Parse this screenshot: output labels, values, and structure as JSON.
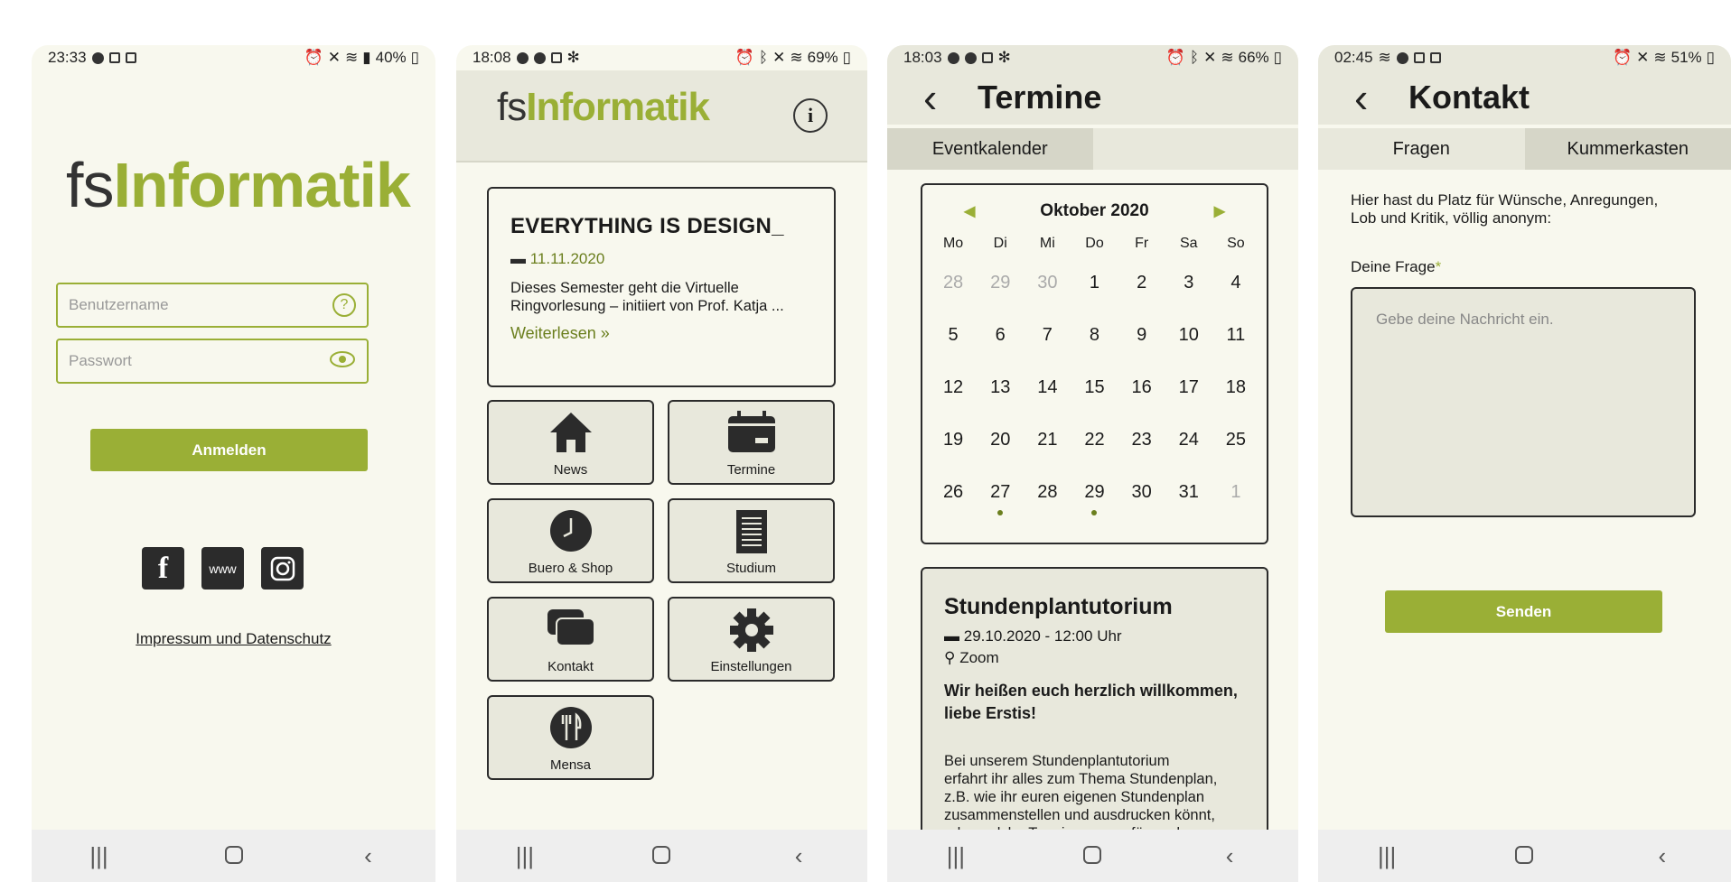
{
  "colors": {
    "accent": "#9aaf36",
    "dark": "#2b2b2b",
    "bg": "#f8f8ee",
    "header": "#e8e8dc"
  },
  "s1": {
    "status": {
      "time": "23:33",
      "battery": "40%"
    },
    "logo": {
      "fs": "fs",
      "name": "Informatik"
    },
    "username_placeholder": "Benutzername",
    "password_placeholder": "Passwort",
    "login": "Anmelden",
    "www": "www",
    "impressum": "Impressum und Datenschutz"
  },
  "s2": {
    "status": {
      "time": "18:08",
      "battery": "69%"
    },
    "logo": {
      "fs": "fs",
      "name": "Informatik"
    },
    "news": {
      "title": "EVERYTHING IS DESIGN_",
      "date": "11.11.2020",
      "line1": "Dieses Semester geht die Virtuelle",
      "line2": "Ringvorlesung – initiiert von Prof. Katja ...",
      "more": "Weiterlesen"
    },
    "tiles": {
      "news": "News",
      "termine": "Termine",
      "buero": "Buero & Shop",
      "studium": "Studium",
      "kontakt": "Kontakt",
      "einstellungen": "Einstellungen",
      "mensa": "Mensa"
    }
  },
  "s3": {
    "status": {
      "time": "18:03",
      "battery": "66%"
    },
    "title": "Termine",
    "tab": "Eventkalender",
    "month": "Oktober 2020",
    "weekdays": [
      "Mo",
      "Di",
      "Mi",
      "Do",
      "Fr",
      "Sa",
      "So"
    ],
    "days": [
      {
        "d": "28",
        "m": true
      },
      {
        "d": "29",
        "m": true
      },
      {
        "d": "30",
        "m": true
      },
      {
        "d": "1"
      },
      {
        "d": "2"
      },
      {
        "d": "3"
      },
      {
        "d": "4"
      },
      {
        "d": "5"
      },
      {
        "d": "6"
      },
      {
        "d": "7"
      },
      {
        "d": "8"
      },
      {
        "d": "9"
      },
      {
        "d": "10"
      },
      {
        "d": "11"
      },
      {
        "d": "12"
      },
      {
        "d": "13"
      },
      {
        "d": "14"
      },
      {
        "d": "15"
      },
      {
        "d": "16"
      },
      {
        "d": "17"
      },
      {
        "d": "18"
      },
      {
        "d": "19"
      },
      {
        "d": "20"
      },
      {
        "d": "21"
      },
      {
        "d": "22"
      },
      {
        "d": "23"
      },
      {
        "d": "24"
      },
      {
        "d": "25"
      },
      {
        "d": "26"
      },
      {
        "d": "27",
        "e": true
      },
      {
        "d": "28"
      },
      {
        "d": "29",
        "e": true
      },
      {
        "d": "30"
      },
      {
        "d": "31"
      },
      {
        "d": "1",
        "m": true
      }
    ],
    "event": {
      "title": "Stundenplantutorium",
      "date": "29.10.2020 - 12:00 Uhr",
      "place": "Zoom",
      "headline1": "Wir heißen euch herzlich willkommen,",
      "headline2": "liebe Erstis!",
      "text1": "Bei unserem Stundenplantutorium",
      "text2": "erfahrt ihr alles zum Thema Stundenplan,",
      "text3": "z.B. wie ihr euren eigenen Stundenplan",
      "text4": "zusammenstellen und ausdrucken könnt,",
      "text5": "oder welche Termine genau für euch"
    }
  },
  "s4": {
    "status": {
      "time": "02:45",
      "battery": "51%"
    },
    "title": "Kontakt",
    "tab1": "Fragen",
    "tab2": "Kummerkasten",
    "intro1": "Hier hast du Platz für Wünsche, Anregungen,",
    "intro2": "Lob und Kritik, völlig anonym:",
    "label": "Deine Frage",
    "required": "*",
    "placeholder": "Gebe deine Nachricht ein.",
    "send": "Senden"
  }
}
